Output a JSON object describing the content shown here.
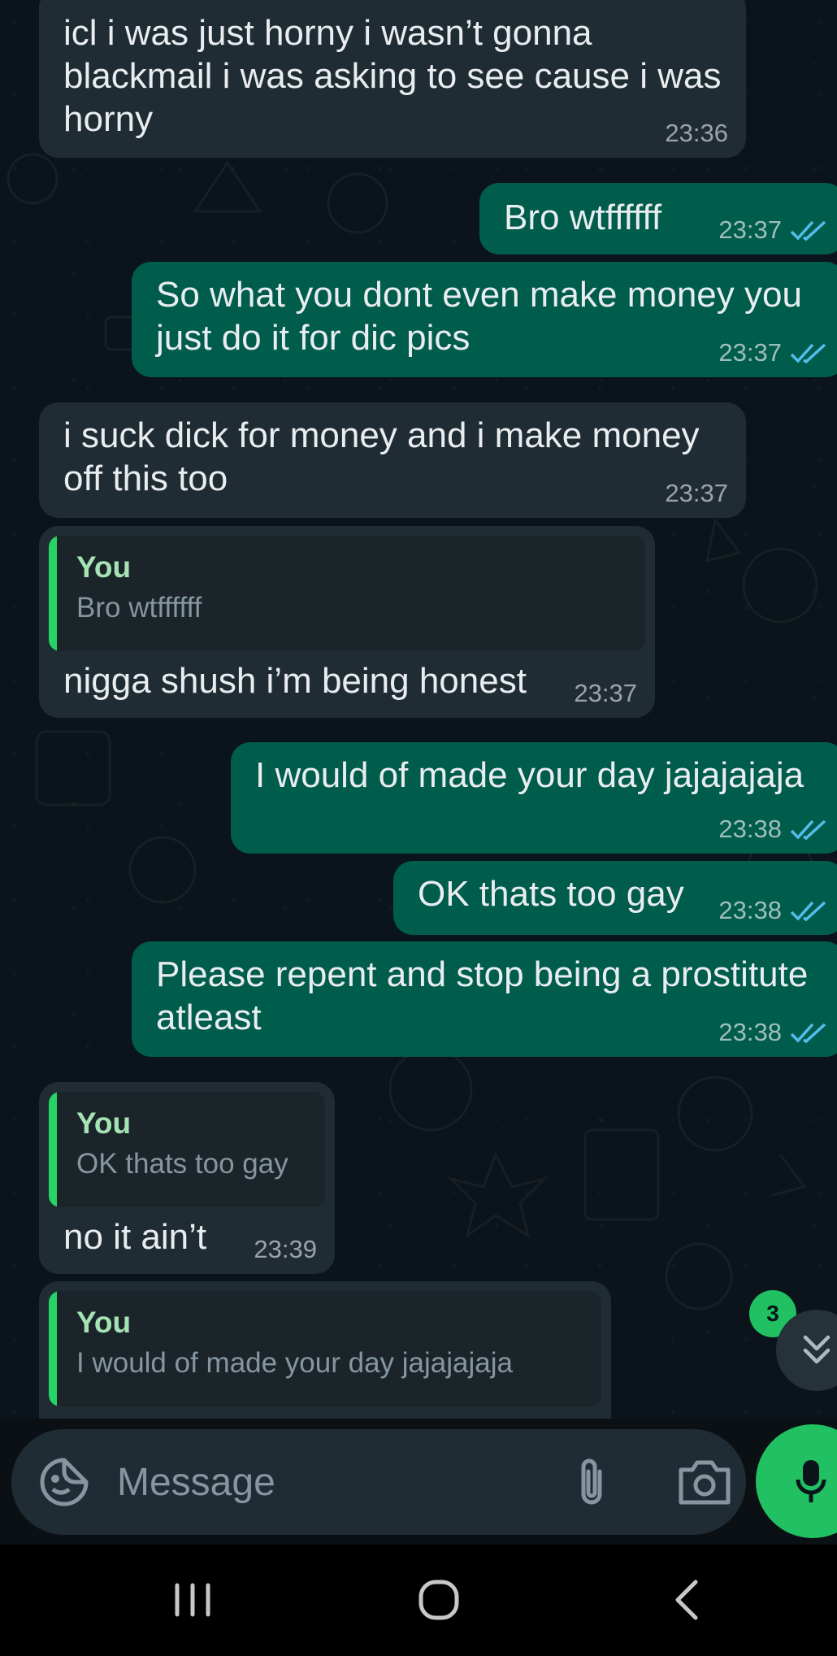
{
  "chat": {
    "messages": [
      {
        "dir": "in",
        "text": "icl i was just horny i wasn’t gonna blackmail i was asking to see cause i was horny",
        "time": "23:36"
      },
      {
        "dir": "out",
        "text": "Bro wtffffff",
        "time": "23:37"
      },
      {
        "dir": "out",
        "text": "So what you dont even make money you just do it for dic pics",
        "time": "23:37"
      },
      {
        "dir": "in",
        "text": "i suck dick for money and i make money off this too",
        "time": "23:37"
      },
      {
        "dir": "in",
        "quote_author": "You",
        "quote_text": "Bro wtffffff",
        "text": "nigga shush i’m being honest",
        "time": "23:37"
      },
      {
        "dir": "out",
        "text": "I would of made your day jajajajaja",
        "time": "23:38"
      },
      {
        "dir": "out",
        "text": "OK thats too gay",
        "time": "23:38"
      },
      {
        "dir": "out",
        "text": "Please repent and stop being a prostitute atleast",
        "time": "23:38"
      },
      {
        "dir": "in",
        "quote_author": "You",
        "quote_text": "OK thats too gay",
        "text": "no it ain’t",
        "time": "23:39"
      },
      {
        "dir": "in",
        "quote_author": "You",
        "quote_text": "I would of made your day jajajajaja",
        "text": "",
        "time": ""
      }
    ],
    "unread_count": "3"
  },
  "composer": {
    "placeholder": "Message",
    "icons": [
      "emoji-sticker-icon",
      "paperclip-icon",
      "camera-icon",
      "microphone-icon"
    ]
  },
  "navbar": {
    "icons": [
      "recent-apps-icon",
      "home-icon",
      "back-icon"
    ]
  },
  "colors": {
    "background": "#0b141a",
    "incoming_bubble": "#202c33",
    "outgoing_bubble": "#005c4b",
    "accent_green": "#21c063",
    "read_ticks": "#53bdeb",
    "quote_author": "#a6e3b4"
  }
}
